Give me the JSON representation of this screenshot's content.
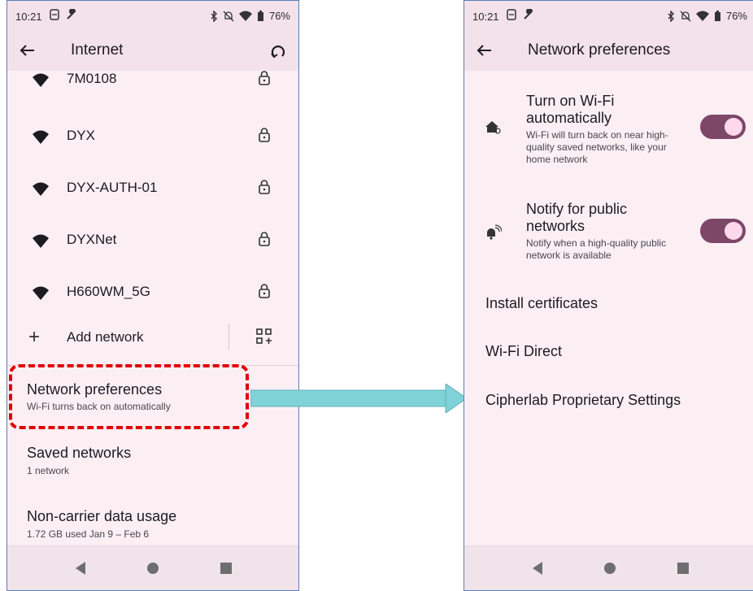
{
  "left_phone": {
    "status": {
      "time": "10:21",
      "battery": "76%"
    },
    "appbar": {
      "title": "Internet"
    },
    "networks": [
      {
        "name": "7M0108",
        "badge": "4"
      },
      {
        "name": "DYX",
        "badge": "4"
      },
      {
        "name": "DYX-AUTH-01",
        "badge": "4"
      },
      {
        "name": "DYXNet",
        "badge": "4"
      },
      {
        "name": "H660WM_5G",
        "badge": "5"
      }
    ],
    "add_network": {
      "label": "Add network",
      "plus": "+"
    },
    "items": [
      {
        "title": "Network preferences",
        "subtitle": "Wi-Fi turns back on automatically"
      },
      {
        "title": "Saved networks",
        "subtitle": "1 network"
      },
      {
        "title": "Non-carrier data usage",
        "subtitle": "1.72 GB used Jan 9 – Feb 6"
      }
    ]
  },
  "right_phone": {
    "status": {
      "time": "10:21",
      "battery": "76%"
    },
    "appbar": {
      "title": "Network preferences"
    },
    "toggles": [
      {
        "title": "Turn on Wi-Fi automatically",
        "subtitle": "Wi-Fi will turn back on near high-quality saved networks, like your home network",
        "on": true
      },
      {
        "title": "Notify for public networks",
        "subtitle": "Notify when a high-quality public network is available",
        "on": true
      }
    ],
    "items": [
      "Install certificates",
      "Wi-Fi Direct",
      "Cipherlab Proprietary Settings"
    ]
  },
  "colors": {
    "accent": "#7d4867",
    "highlight": "#e10000",
    "arrow": "#7fd3d8",
    "background": "#fbeff4"
  }
}
